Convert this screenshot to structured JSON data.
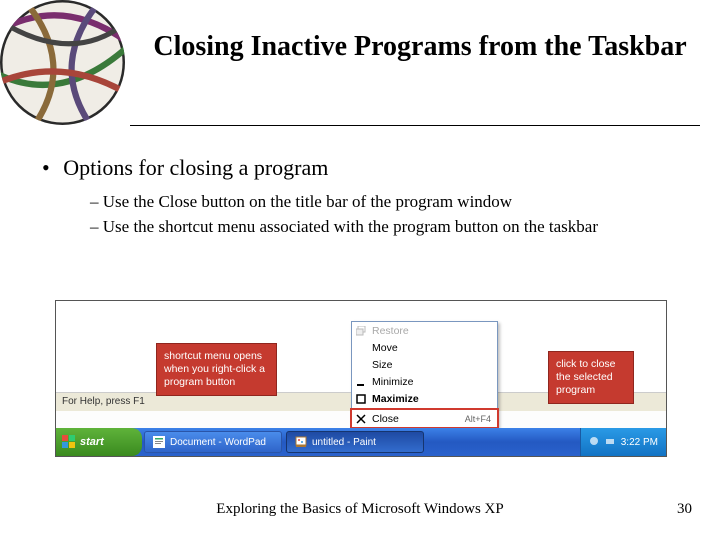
{
  "title": "Closing Inactive Programs from the Taskbar",
  "bullet": "Options for closing a program",
  "sub_bullets": [
    "Use the Close button on the title bar of the program window",
    "Use the shortcut menu associated with the program button on the taskbar"
  ],
  "statusbar_text": "For Help, press F1",
  "callout_left": "shortcut menu opens when you right-click a program button",
  "callout_right": "click to close the selected program",
  "menu": {
    "restore": "Restore",
    "move": "Move",
    "size": "Size",
    "minimize": "Minimize",
    "maximize": "Maximize",
    "close": "Close",
    "close_shortcut": "Alt+F4"
  },
  "taskbar": {
    "start": "start",
    "task1": "Document - WordPad",
    "task2": "untitled - Paint",
    "clock": "3:22 PM"
  },
  "footer": "Exploring the Basics of Microsoft Windows XP",
  "page": "30"
}
